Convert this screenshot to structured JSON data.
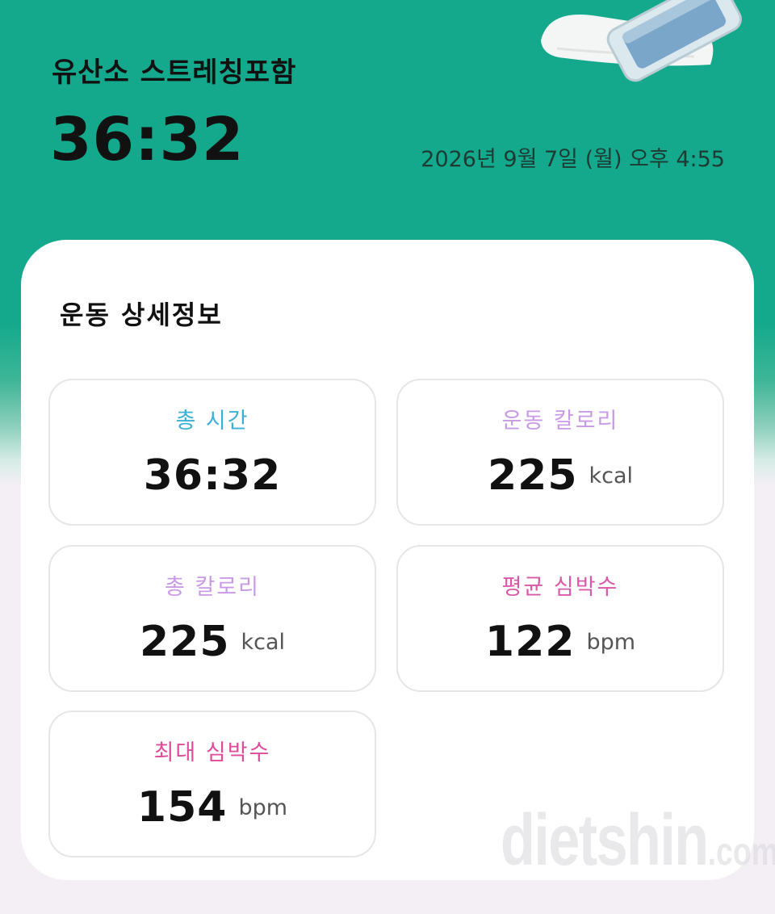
{
  "colors": {
    "header_green": "#14a98c",
    "label_blue": "#3ab0d8",
    "label_lilac": "#c99ae6",
    "label_pink": "#d958a8",
    "label_magenta": "#e04a9a"
  },
  "header": {
    "workout_name": "유산소 스트레칭포함",
    "duration": "36:32",
    "datetime": "2026년 9월 7일 (월) 오후 4:55"
  },
  "details": {
    "title": "운동 상세정보",
    "stats": [
      {
        "label": "총 시간",
        "value": "36:32",
        "unit": ""
      },
      {
        "label": "운동 칼로리",
        "value": "225",
        "unit": "kcal"
      },
      {
        "label": "총 칼로리",
        "value": "225",
        "unit": "kcal"
      },
      {
        "label": "평균 심박수",
        "value": "122",
        "unit": "bpm"
      },
      {
        "label": "최대 심박수",
        "value": "154",
        "unit": "bpm"
      }
    ]
  },
  "watermark": {
    "brand": "dietshin",
    "suffix": ".com"
  }
}
